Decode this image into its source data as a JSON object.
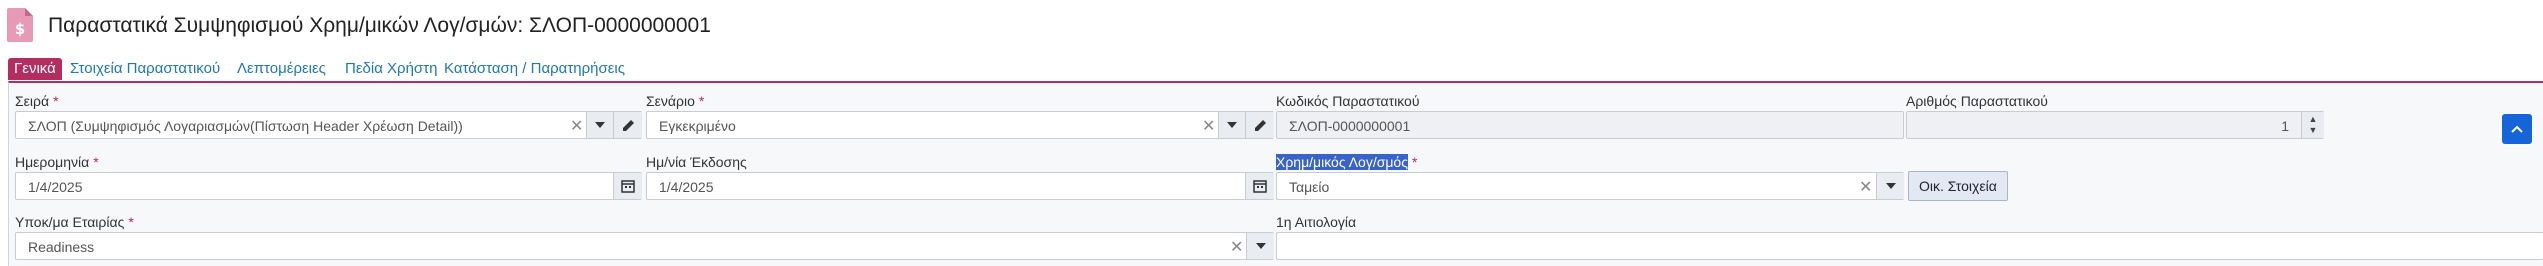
{
  "page": {
    "title": "Παραστατικά Συμψηφισμού Χρημ/μικών Λογ/σμών: ΣΛΟΠ-0000000001"
  },
  "tabs": [
    {
      "label": "Γενικά",
      "active": true
    },
    {
      "label": "Στοιχεία Παραστατικού"
    },
    {
      "label": "Λεπτομέρειες"
    },
    {
      "label": "Πεδία Χρήστη"
    },
    {
      "label": "Κατάσταση / Παρατηρήσεις"
    }
  ],
  "form": {
    "series": {
      "label": "Σειρά",
      "required": "*",
      "value": "ΣΛΟΠ (Συμψηφισμός Λογαριασμών(Πίστωση Header Χρέωση Detail))"
    },
    "scenario": {
      "label": "Σενάριο",
      "required": "*",
      "value": "Εγκεκριμένο"
    },
    "doc_code": {
      "label": "Κωδικός Παραστατικού",
      "value": "ΣΛΟΠ-0000000001"
    },
    "doc_number": {
      "label": "Αριθμός Παραστατικού",
      "value": "1"
    },
    "date": {
      "label": "Ημερομηνία",
      "required": "*",
      "value": "1/4/2025"
    },
    "issue_date": {
      "label": "Ημ/νία Έκδοσης",
      "value": "1/4/2025"
    },
    "fin_account": {
      "label": "Χρημ/μικός Λογ/σμός",
      "required": "*",
      "value": "Ταμείο",
      "extra_button": "Οικ. Στοιχεία"
    },
    "branch": {
      "label": "Υποκ/μα Εταιρίας",
      "required": "*",
      "value": "Readiness"
    },
    "reason": {
      "label": "1η Αιτιολογία",
      "value": ""
    }
  },
  "colors": {
    "accent": "#b32d5e",
    "primary": "#1565d8",
    "link": "#1f77b4"
  },
  "icons": [
    "document-dollar-icon",
    "close-icon",
    "caret-down-icon",
    "pencil-icon",
    "calendar-icon",
    "chevron-up-icon"
  ]
}
